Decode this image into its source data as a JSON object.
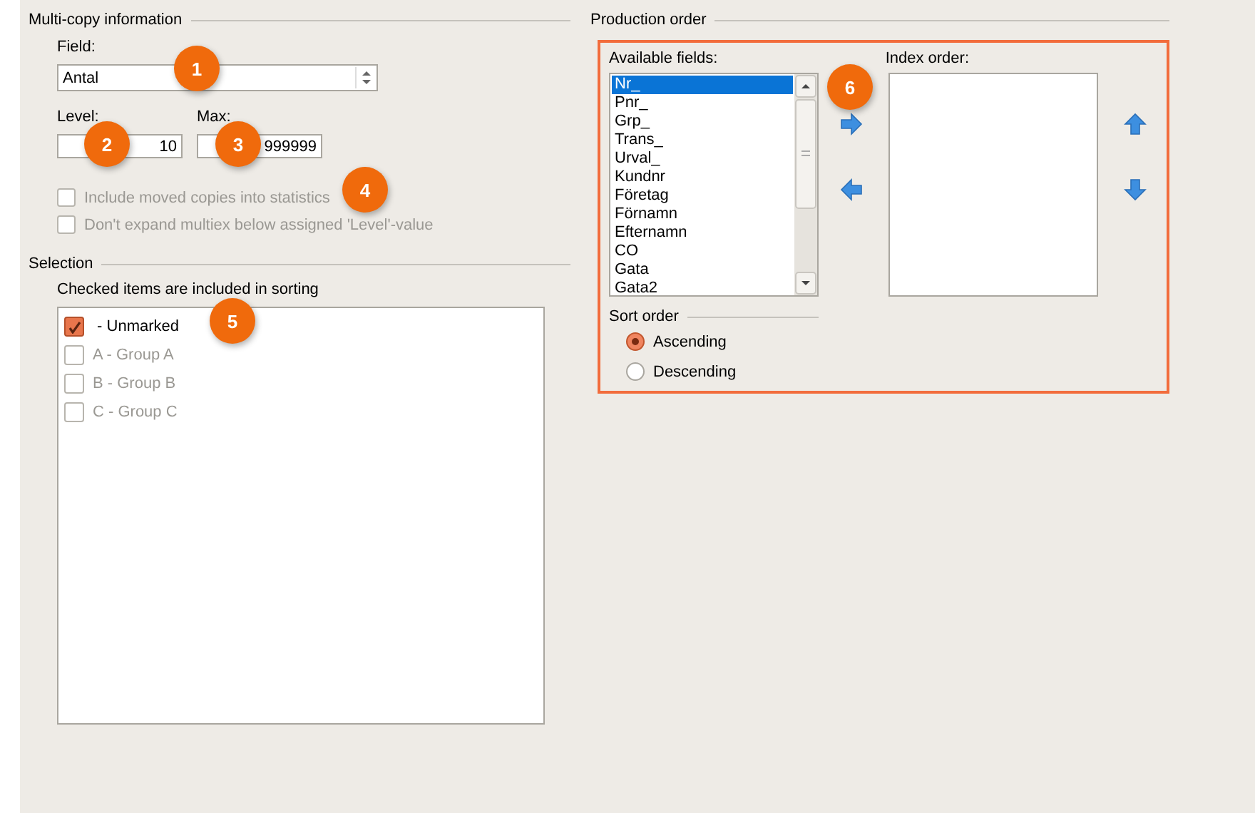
{
  "multi_copy": {
    "title": "Multi-copy information",
    "field": {
      "label": "Field:",
      "value": "Antal"
    },
    "level": {
      "label": "Level:",
      "value": "10"
    },
    "max": {
      "label": "Max:",
      "value": "999999"
    },
    "options": [
      {
        "label": "Include moved copies into statistics",
        "checked": false,
        "disabled": true
      },
      {
        "label": "Don't expand multiex below assigned 'Level'-value",
        "checked": false,
        "disabled": true
      }
    ]
  },
  "selection": {
    "title": "Selection",
    "hint": "Checked items are included in sorting",
    "items": [
      {
        "label": " - Unmarked",
        "checked": true
      },
      {
        "label": "A - Group A",
        "checked": false
      },
      {
        "label": "B - Group B",
        "checked": false
      },
      {
        "label": "C - Group C",
        "checked": false
      }
    ]
  },
  "production": {
    "title": "Production order",
    "available": {
      "label": "Available fields:",
      "items": [
        {
          "label": "Nr_",
          "selected": true
        },
        {
          "label": "Pnr_",
          "selected": false
        },
        {
          "label": "Grp_",
          "selected": false
        },
        {
          "label": "Trans_",
          "selected": false
        },
        {
          "label": "Urval_",
          "selected": false
        },
        {
          "label": "Kundnr",
          "selected": false
        },
        {
          "label": "Företag",
          "selected": false
        },
        {
          "label": "Förnamn",
          "selected": false
        },
        {
          "label": "Efternamn",
          "selected": false
        },
        {
          "label": "CO",
          "selected": false
        },
        {
          "label": "Gata",
          "selected": false
        },
        {
          "label": "Gata2",
          "selected": false
        }
      ]
    },
    "index": {
      "label": "Index order:"
    },
    "sort": {
      "title": "Sort order",
      "options": [
        {
          "label": "Ascending",
          "selected": true
        },
        {
          "label": "Descending",
          "selected": false
        }
      ]
    }
  },
  "badges": [
    "1",
    "2",
    "3",
    "4",
    "5",
    "6"
  ]
}
